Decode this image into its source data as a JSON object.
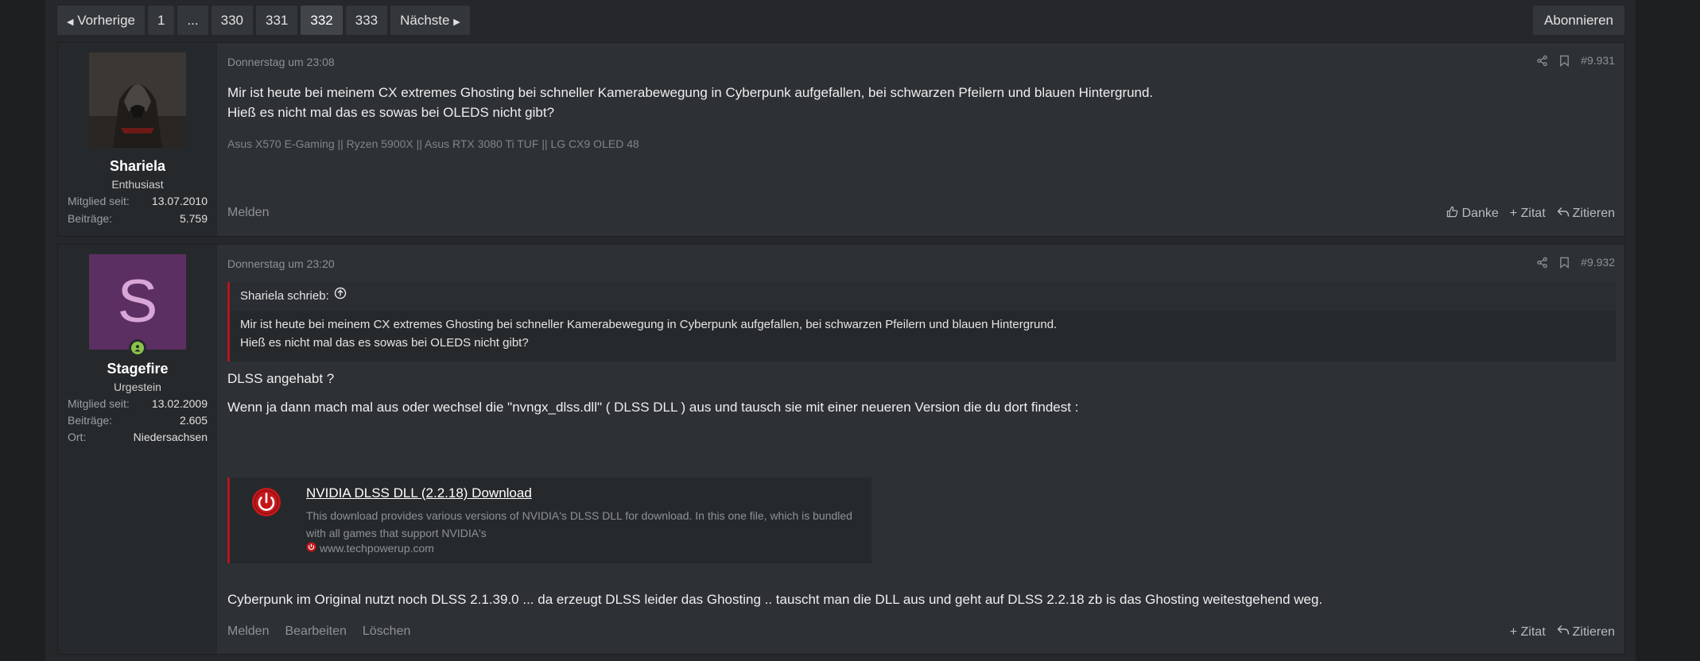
{
  "pagination": {
    "prev": "Vorherige",
    "pages": [
      "1",
      "...",
      "330",
      "331",
      "332",
      "333"
    ],
    "current": "332",
    "next": "Nächste",
    "subscribe": "Abonnieren"
  },
  "posts": [
    {
      "user": {
        "name": "Shariela",
        "title": "Enthusiast",
        "stats": [
          {
            "key": "Mitglied seit:",
            "value": "13.07.2010"
          },
          {
            "key": "Beiträge:",
            "value": "5.759"
          }
        ]
      },
      "date": "Donnerstag um 23:08",
      "number": "#9.931",
      "lines": [
        "Mir ist heute bei meinem CX extremes Ghosting bei schneller Kamerabewegung in Cyberpunk aufgefallen, bei schwarzen Pfeilern und blauen Hintergrund.",
        "Hieß es nicht mal das es sowas bei OLEDS nicht gibt?"
      ],
      "signature": "Asus X570 E-Gaming || Ryzen 5900X || Asus RTX 3080 Ti TUF || LG CX9 OLED 48",
      "actions_left": [
        "Melden"
      ],
      "actions_right": [
        "Danke",
        "+ Zitat",
        "Zitieren"
      ]
    },
    {
      "user": {
        "name": "Stagefire",
        "title": "Urgestein",
        "avatar_letter": "S",
        "stats": [
          {
            "key": "Mitglied seit:",
            "value": "13.02.2009"
          },
          {
            "key": "Beiträge:",
            "value": "2.605"
          },
          {
            "key": "Ort:",
            "value": "Niedersachsen"
          }
        ]
      },
      "date": "Donnerstag um 23:20",
      "number": "#9.932",
      "quote": {
        "author": "Shariela schrieb:",
        "lines": [
          "Mir ist heute bei meinem CX extremes Ghosting bei schneller Kamerabewegung in Cyberpunk aufgefallen, bei schwarzen Pfeilern und blauen Hintergrund.",
          "Hieß es nicht mal das es sowas bei OLEDS nicht gibt?"
        ]
      },
      "text1": "DLSS angehabt ?",
      "text2": "Wenn ja dann mach mal aus oder wechsel die \"nvngx_dlss.dll\" ( DLSS DLL ) aus und tausch sie mit einer neueren Version die du dort findest :",
      "link": {
        "title": "NVIDIA DLSS DLL (2.2.18) Download",
        "description": "This download provides various versions of NVIDIA's DLSS DLL for download. In this one file, which is bundled with all games that support NVIDIA's",
        "site": "www.techpowerup.com"
      },
      "text3": "Cyberpunk im Original nutzt noch DLSS 2.1.39.0 ... da erzeugt DLSS leider das Ghosting .. tauscht man die DLL aus und geht auf DLSS 2.2.18 zb is das Ghosting weitestgehend weg.",
      "actions_left": [
        "Melden",
        "Bearbeiten",
        "Löschen"
      ],
      "actions_right": [
        "+ Zitat",
        "Zitieren"
      ]
    }
  ],
  "colors": {
    "background": "#1d1f21",
    "post": "#2d3034",
    "usercell": "#26292c",
    "accent_red": "#b3171b",
    "online": "#8bc34a",
    "avatar_bg": "#5c2f63"
  }
}
